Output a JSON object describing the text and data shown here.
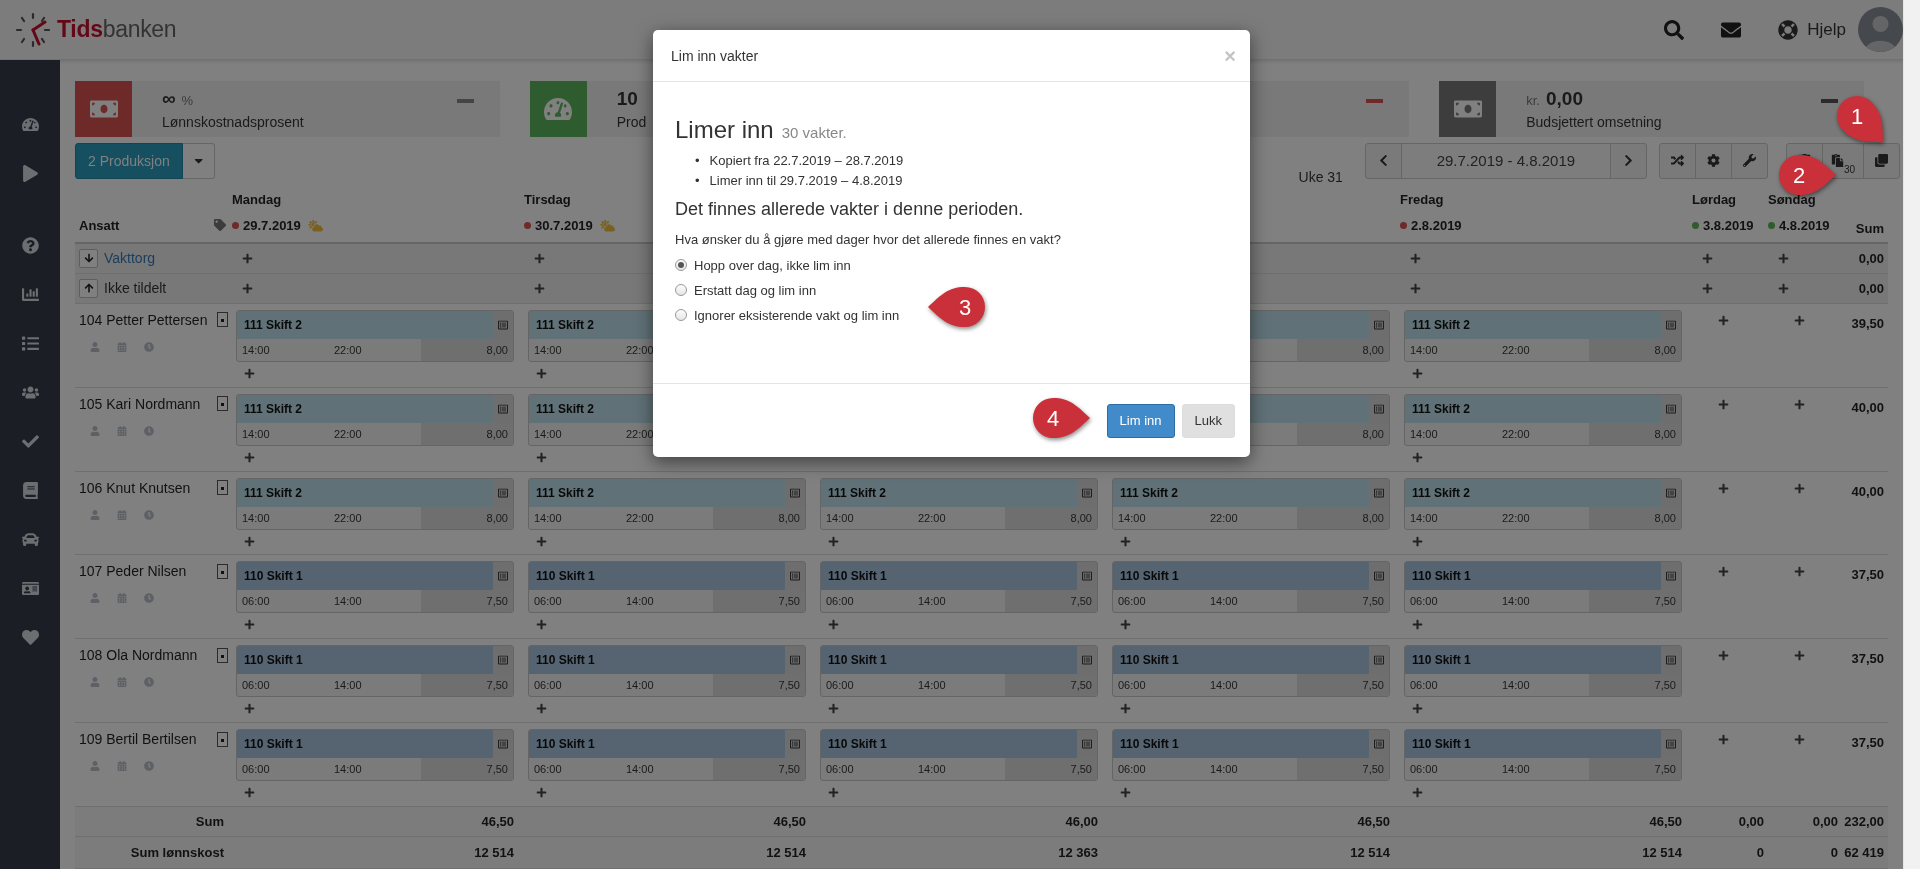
{
  "topbar": {
    "logo": {
      "brand": "Tids",
      "brand_rest": "banken"
    },
    "help": "Hjelp"
  },
  "kpis": [
    {
      "kind": "money",
      "color": "#6d2a28",
      "value": "∞",
      "suffix": "%",
      "label": "Lønnskostnadsprosent",
      "trend": {
        "color": "#454545"
      }
    },
    {
      "kind": "gauge",
      "color": "#2e5c2e",
      "value": "10",
      "label": "Prod"
    },
    {
      "kind": "hidden",
      "trend": {
        "color": "#6d2a28"
      }
    },
    {
      "kind": "money",
      "color": "#3d3d3d",
      "prefix": "kr.",
      "value": "0,00",
      "label": "Budsjettert omsetning",
      "trend": {
        "color": "#2b2b2b"
      }
    }
  ],
  "toolbar": {
    "department": "2 Produksjon",
    "week": "Uke 31",
    "range": "29.7.2019 - 4.8.2019",
    "paste_count": "30"
  },
  "table": {
    "employee_heading": "Ansatt",
    "sum_heading": "Sum",
    "days": [
      {
        "kind": "day",
        "name": "Mandag",
        "date": "29.7.2019",
        "color": "#6d2a28",
        "forecast": true
      },
      {
        "kind": "day",
        "name": "Tirsdag",
        "date": "30.7.2019",
        "color": "#6d2a28",
        "forecast": true
      },
      {
        "kind": "hidden"
      },
      {
        "kind": "hidden"
      },
      {
        "kind": "day",
        "name": "Fredag",
        "date": "2.8.2019",
        "color": "#6d2a28",
        "forecast": false
      },
      {
        "kind": "day",
        "name": "Lørdag",
        "date": "3.8.2019",
        "color": "#2e5c2e",
        "forecast": false
      },
      {
        "kind": "day",
        "name": "Søndag",
        "date": "4.8.2019",
        "color": "#2e5c2e",
        "forecast": false
      }
    ],
    "pools": [
      {
        "kind": "down",
        "label": "Vakttorg",
        "link": true,
        "cells": [
          {
            "kind": "add"
          },
          {
            "kind": "add"
          },
          {
            "kind": "hidden"
          },
          {
            "kind": "hidden"
          },
          {
            "kind": "add"
          },
          {
            "kind": "add"
          },
          {
            "kind": "add"
          }
        ],
        "sum": "0,00"
      },
      {
        "kind": "up",
        "label": "Ikke tildelt",
        "link": false,
        "cells": [
          {
            "kind": "add"
          },
          {
            "kind": "add"
          },
          {
            "kind": "hidden"
          },
          {
            "kind": "hidden"
          },
          {
            "kind": "add"
          },
          {
            "kind": "add"
          },
          {
            "kind": "add"
          }
        ],
        "sum": "0,00"
      }
    ],
    "rows": [
      {
        "name": "104 Petter Pettersen",
        "sum": "39,50",
        "cells": [
          {
            "kind": "shift",
            "title": "111 Skift 2",
            "start": "14:00",
            "end": "22:00",
            "hours": "8,00",
            "color": "#607277"
          },
          {
            "kind": "shift",
            "title": "111 Skift 2",
            "start": "14:00",
            "end": "22:00",
            "color": "#607277"
          },
          {
            "kind": "hidden"
          },
          {
            "kind": "shift",
            "hours": "8,00",
            "color": "#607277"
          },
          {
            "kind": "shift",
            "title": "111 Skift 2",
            "start": "14:00",
            "end": "22:00",
            "hours": "8,00",
            "color": "#607277"
          },
          {
            "kind": "add"
          },
          {
            "kind": "add"
          }
        ]
      },
      {
        "name": "105 Kari Nordmann",
        "sum": "40,00",
        "cells": [
          {
            "kind": "shift",
            "title": "111 Skift 2",
            "start": "14:00",
            "end": "22:00",
            "hours": "8,00",
            "color": "#607277"
          },
          {
            "kind": "shift",
            "title": "111 Skift 2",
            "start": "14:00",
            "end": "22:00",
            "color": "#607277"
          },
          {
            "kind": "hidden"
          },
          {
            "kind": "shift",
            "hours": "8,00",
            "color": "#607277"
          },
          {
            "kind": "shift",
            "title": "111 Skift 2",
            "start": "14:00",
            "end": "22:00",
            "hours": "8,00",
            "color": "#607277"
          },
          {
            "kind": "add"
          },
          {
            "kind": "add"
          }
        ]
      },
      {
        "name": "106 Knut Knutsen",
        "sum": "40,00",
        "cells": [
          {
            "kind": "shift",
            "title": "111 Skift 2",
            "start": "14:00",
            "end": "22:00",
            "hours": "8,00",
            "color": "#607277"
          },
          {
            "kind": "shift",
            "title": "111 Skift 2",
            "start": "14:00",
            "end": "22:00",
            "hours": "8,00",
            "color": "#607277"
          },
          {
            "kind": "shift",
            "title": "111 Skift 2",
            "start": "14:00",
            "end": "22:00",
            "hours": "8,00",
            "color": "#607277"
          },
          {
            "kind": "shift",
            "title": "111 Skift 2",
            "start": "14:00",
            "end": "22:00",
            "hours": "8,00",
            "color": "#607277"
          },
          {
            "kind": "shift",
            "title": "111 Skift 2",
            "start": "14:00",
            "end": "22:00",
            "hours": "8,00",
            "color": "#607277"
          },
          {
            "kind": "add"
          },
          {
            "kind": "add"
          }
        ]
      },
      {
        "name": "107 Peder Nilsen",
        "sum": "37,50",
        "cells": [
          {
            "kind": "shift",
            "title": "110 Skift 1",
            "start": "06:00",
            "end": "14:00",
            "hours": "7,50",
            "color": "#556470"
          },
          {
            "kind": "shift",
            "title": "110 Skift 1",
            "start": "06:00",
            "end": "14:00",
            "hours": "7,50",
            "color": "#556470"
          },
          {
            "kind": "shift",
            "title": "110 Skift 1",
            "start": "06:00",
            "end": "14:00",
            "hours": "7,50",
            "color": "#556470"
          },
          {
            "kind": "shift",
            "title": "110 Skift 1",
            "start": "06:00",
            "end": "14:00",
            "hours": "7,50",
            "color": "#556470"
          },
          {
            "kind": "shift",
            "title": "110 Skift 1",
            "start": "06:00",
            "end": "14:00",
            "hours": "7,50",
            "color": "#556470"
          },
          {
            "kind": "add"
          },
          {
            "kind": "add"
          }
        ]
      },
      {
        "name": "108 Ola Nordmann",
        "sum": "37,50",
        "cells": [
          {
            "kind": "shift",
            "title": "110 Skift 1",
            "start": "06:00",
            "end": "14:00",
            "hours": "7,50",
            "color": "#556470"
          },
          {
            "kind": "shift",
            "title": "110 Skift 1",
            "start": "06:00",
            "end": "14:00",
            "hours": "7,50",
            "color": "#556470"
          },
          {
            "kind": "shift",
            "title": "110 Skift 1",
            "start": "06:00",
            "end": "14:00",
            "hours": "7,50",
            "color": "#556470"
          },
          {
            "kind": "shift",
            "title": "110 Skift 1",
            "start": "06:00",
            "end": "14:00",
            "hours": "7,50",
            "color": "#556470"
          },
          {
            "kind": "shift",
            "title": "110 Skift 1",
            "start": "06:00",
            "end": "14:00",
            "hours": "7,50",
            "color": "#556470"
          },
          {
            "kind": "add"
          },
          {
            "kind": "add"
          }
        ]
      },
      {
        "name": "109 Bertil Bertilsen",
        "sum": "37,50",
        "cells": [
          {
            "kind": "shift",
            "title": "110 Skift 1",
            "start": "06:00",
            "end": "14:00",
            "hours": "7,50",
            "color": "#556470"
          },
          {
            "kind": "shift",
            "title": "110 Skift 1",
            "start": "06:00",
            "end": "14:00",
            "hours": "7,50",
            "color": "#556470"
          },
          {
            "kind": "shift",
            "title": "110 Skift 1",
            "start": "06:00",
            "end": "14:00",
            "hours": "7,50",
            "color": "#556470"
          },
          {
            "kind": "shift",
            "title": "110 Skift 1",
            "start": "06:00",
            "end": "14:00",
            "hours": "7,50",
            "color": "#556470"
          },
          {
            "kind": "shift",
            "title": "110 Skift 1",
            "start": "06:00",
            "end": "14:00",
            "hours": "7,50",
            "color": "#556470"
          },
          {
            "kind": "add"
          },
          {
            "kind": "add"
          }
        ]
      }
    ],
    "totals": [
      {
        "label": "Sum",
        "values": [
          "46,50",
          "46,50",
          "46,00",
          "46,50",
          "46,50",
          "0,00",
          "0,00",
          "232,00"
        ]
      },
      {
        "label": "Sum lønnskost",
        "values": [
          "12 514",
          "12 514",
          "12 363",
          "12 514",
          "12 514",
          "0",
          "0",
          "62 419"
        ]
      }
    ]
  },
  "modal": {
    "title": "Lim inn vakter",
    "close": "×",
    "heading": "Limer inn",
    "heading_note": "30 vakter.",
    "bullets": [
      {
        "marker": "•",
        "text": "Kopiert fra 22.7.2019 – 28.7.2019"
      },
      {
        "marker": "•",
        "text": "Limer inn til 29.7.2019 – 4.8.2019"
      }
    ],
    "notice": "Det finnes allerede vakter i denne perioden.",
    "question": "Hva ønsker du å gjøre med dager hvor det allerede finnes en vakt?",
    "options": [
      {
        "label": "Hopp over dag, ikke lim inn",
        "selected": true
      },
      {
        "label": "Erstatt dag og lim inn",
        "selected": false
      },
      {
        "label": "Ignorer eksisterende vakt og lim inn",
        "selected": false
      }
    ],
    "buttons": [
      {
        "label": "Lim inn",
        "kind": "primary"
      },
      {
        "label": "Lukk",
        "kind": "default"
      }
    ]
  },
  "markers": [
    {
      "label": "1"
    },
    {
      "label": "2"
    },
    {
      "label": "3"
    },
    {
      "label": "4"
    }
  ]
}
